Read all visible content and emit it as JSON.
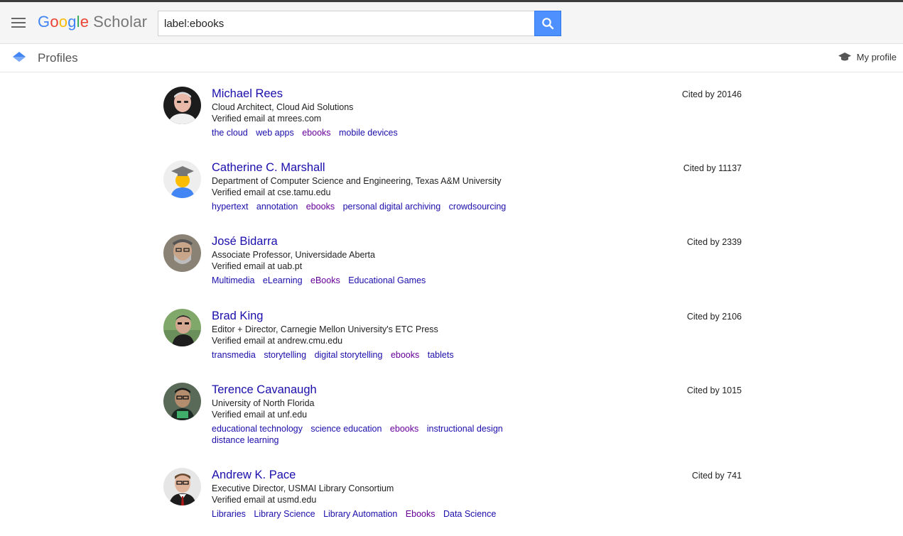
{
  "header": {
    "logo": {
      "G": "G",
      "o1": "o",
      "o2": "o",
      "g": "g",
      "l": "l",
      "e": "e",
      "scholar": "Scholar"
    },
    "search_value": "label:ebooks"
  },
  "subheader": {
    "title": "Profiles",
    "my_profile": "My profile"
  },
  "colors": {
    "link": "#1a0dab",
    "visited": "#660099",
    "search_button": "#4d90fe"
  },
  "profiles": [
    {
      "name": "Michael Rees",
      "affiliation": "Cloud Architect, Cloud Aid Solutions",
      "email": "Verified email at mrees.com",
      "cited": "Cited by 20146",
      "tags": [
        {
          "label": "the cloud"
        },
        {
          "label": "web apps"
        },
        {
          "label": "ebooks"
        },
        {
          "label": "mobile devices"
        }
      ]
    },
    {
      "name": "Catherine C. Marshall",
      "affiliation": "Department of Computer Science and Engineering, Texas A&M University",
      "email": "Verified email at cse.tamu.edu",
      "cited": "Cited by 11137",
      "tags": [
        {
          "label": "hypertext"
        },
        {
          "label": "annotation"
        },
        {
          "label": "ebooks"
        },
        {
          "label": "personal digital archiving"
        },
        {
          "label": "crowdsourcing"
        }
      ]
    },
    {
      "name": "José Bidarra",
      "affiliation": "Associate Professor, Universidade Aberta",
      "email": "Verified email at uab.pt",
      "cited": "Cited by 2339",
      "tags": [
        {
          "label": "Multimedia"
        },
        {
          "label": "eLearning"
        },
        {
          "label": "eBooks"
        },
        {
          "label": "Educational Games"
        }
      ]
    },
    {
      "name": "Brad King",
      "affiliation": "Editor + Director, Carnegie Mellon University's ETC Press",
      "email": "Verified email at andrew.cmu.edu",
      "cited": "Cited by 2106",
      "tags": [
        {
          "label": "transmedia"
        },
        {
          "label": "storytelling"
        },
        {
          "label": "digital storytelling"
        },
        {
          "label": "ebooks"
        },
        {
          "label": "tablets"
        }
      ]
    },
    {
      "name": "Terence Cavanaugh",
      "affiliation": "University of North Florida",
      "email": "Verified email at unf.edu",
      "cited": "Cited by 1015",
      "tags": [
        {
          "label": "educational technology"
        },
        {
          "label": "science education"
        },
        {
          "label": "ebooks"
        },
        {
          "label": "instructional design"
        },
        {
          "label": "distance learning"
        }
      ]
    },
    {
      "name": "Andrew K. Pace",
      "affiliation": "Executive Director, USMAI Library Consortium",
      "email": "Verified email at usmd.edu",
      "cited": "Cited by 741",
      "tags": [
        {
          "label": "Libraries"
        },
        {
          "label": "Library Science"
        },
        {
          "label": "Library Automation"
        },
        {
          "label": "Ebooks"
        },
        {
          "label": "Data Science"
        }
      ]
    }
  ]
}
